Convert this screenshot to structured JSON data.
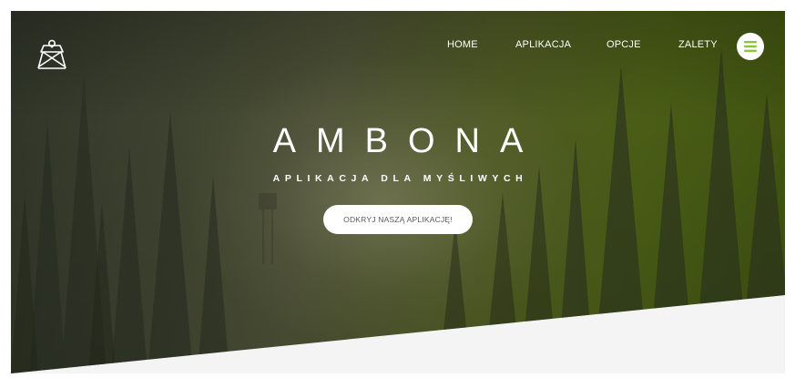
{
  "brand": {
    "logo_icon": "hunting-stand-logo-icon"
  },
  "nav": {
    "items": [
      {
        "label": "HOME"
      },
      {
        "label": "APLIKACJA"
      },
      {
        "label": "OPCJE"
      },
      {
        "label": "ZALETY"
      }
    ],
    "menu_icon": "hamburger-menu-icon"
  },
  "hero": {
    "title": "AMBONA",
    "subtitle": "APLIKACJA DLA MYŚLIWYCH",
    "cta_label": "ODKRYJ NASZĄ APLIKACJĘ!"
  },
  "colors": {
    "accent": "#8cc43c",
    "overlay_dark": "#2f3428",
    "overlay_green": "#4a5d16",
    "lower_background": "#f4f4f4"
  }
}
